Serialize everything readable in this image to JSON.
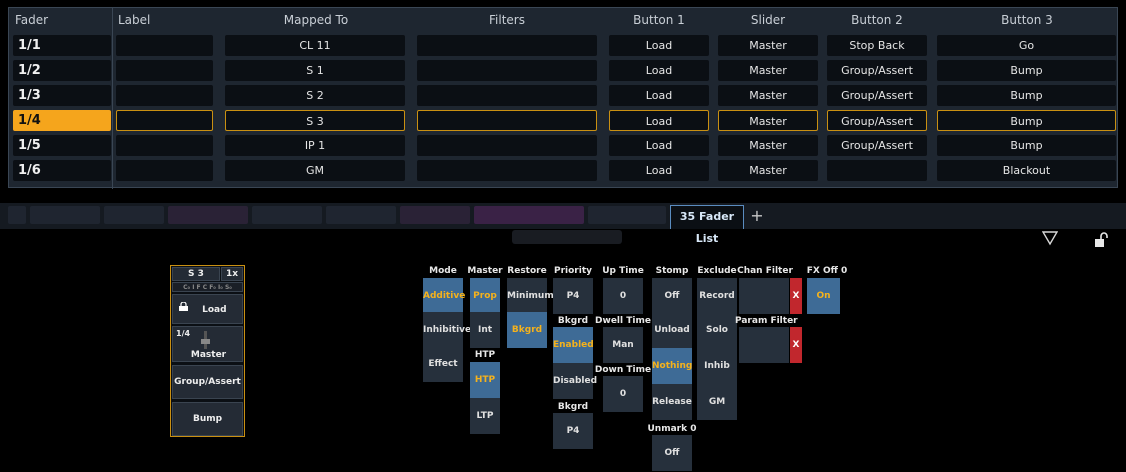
{
  "table": {
    "headers": {
      "fader": "Fader",
      "label": "Label",
      "mapped_to": "Mapped To",
      "filters": "Filters",
      "button1": "Button 1",
      "slider": "Slider",
      "button2": "Button 2",
      "button3": "Button 3"
    },
    "rows": [
      {
        "fader": "1/1",
        "label": "",
        "mapped_to": "CL 11",
        "filters": "",
        "button1": "Load",
        "slider": "Master",
        "button2": "Stop Back",
        "button3": "Go"
      },
      {
        "fader": "1/2",
        "label": "",
        "mapped_to": "S 1",
        "filters": "",
        "button1": "Load",
        "slider": "Master",
        "button2": "Group/Assert",
        "button3": "Bump"
      },
      {
        "fader": "1/3",
        "label": "",
        "mapped_to": "S 2",
        "filters": "",
        "button1": "Load",
        "slider": "Master",
        "button2": "Group/Assert",
        "button3": "Bump"
      },
      {
        "fader": "1/4",
        "label": "",
        "mapped_to": "S 3",
        "filters": "",
        "button1": "Load",
        "slider": "Master",
        "button2": "Group/Assert",
        "button3": "Bump"
      },
      {
        "fader": "1/5",
        "label": "",
        "mapped_to": "IP 1",
        "filters": "",
        "button1": "Load",
        "slider": "Master",
        "button2": "Group/Assert",
        "button3": "Bump"
      },
      {
        "fader": "1/6",
        "label": "",
        "mapped_to": "GM",
        "filters": "",
        "button1": "Load",
        "slider": "Master",
        "button2": "",
        "button3": "Blackout"
      }
    ]
  },
  "tabs": {
    "active": "35 Fader List",
    "add": "+"
  },
  "widget": {
    "target": "S 3",
    "page": "1x",
    "mini": "C₀ I F C F₀ I₀ S₀",
    "load": "Load",
    "fader_id": "1/4",
    "slider": "Master",
    "group": "Group/Assert",
    "bump": "Bump"
  },
  "props": {
    "mode": {
      "header": "Mode",
      "opts": [
        "Additive",
        "Inhibitive",
        "Effect"
      ]
    },
    "master": {
      "header": "Master",
      "opts": [
        "Prop",
        "Int"
      ]
    },
    "htp": {
      "header": "HTP",
      "opts": [
        "HTP",
        "LTP"
      ]
    },
    "restore": {
      "header": "Restore",
      "opts": [
        "Minimum",
        "Bkgrd"
      ]
    },
    "priority": {
      "header": "Priority",
      "value": "P4"
    },
    "bkgrd": {
      "header": "Bkgrd",
      "opts": [
        "Enabled",
        "Disabled"
      ]
    },
    "bkgrd2": {
      "header": "Bkgrd",
      "value": "P4"
    },
    "uptime": {
      "header": "Up Time",
      "value": "0"
    },
    "dwell": {
      "header": "Dwell Time",
      "value": "Man"
    },
    "downtime": {
      "header": "Down Time",
      "value": "0"
    },
    "stomp": {
      "header": "Stomp",
      "opts": [
        "Off",
        "Unload",
        "Nothing",
        "Release"
      ]
    },
    "unmark": {
      "header": "Unmark 0",
      "value": "Off"
    },
    "exclude": {
      "header": "Exclude",
      "opts": [
        "Record",
        "Solo",
        "Inhib",
        "GM"
      ]
    },
    "chan_filter": {
      "header": "Chan Filter",
      "x": "X"
    },
    "param_filter": {
      "header": "Param Filter",
      "x": "X"
    },
    "fxoff": {
      "header": "FX Off 0",
      "value": "On"
    }
  },
  "colors": {
    "accent": "#f5a51c",
    "selected_blue": "#3e6b96",
    "clear_red": "#c1272d"
  }
}
